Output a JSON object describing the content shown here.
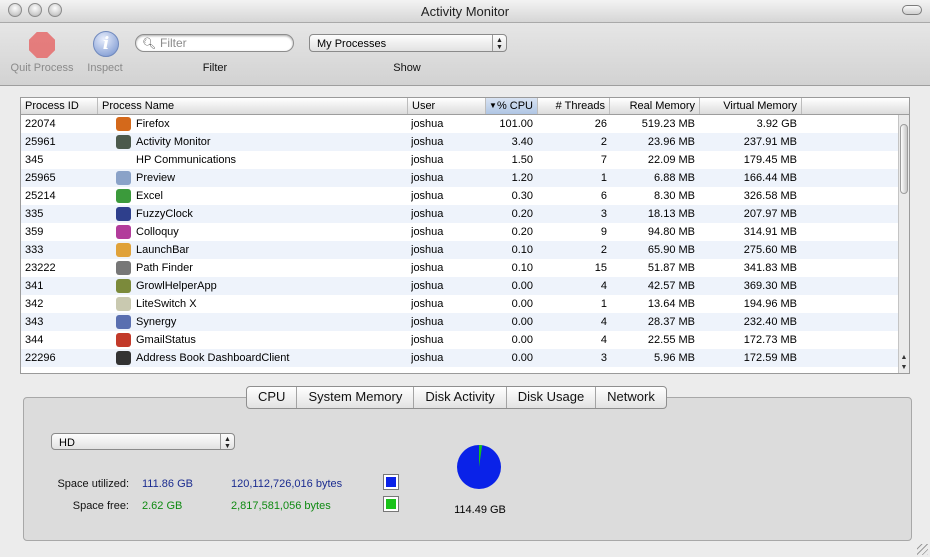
{
  "window": {
    "title": "Activity Monitor"
  },
  "toolbar": {
    "quit_label": "Quit Process",
    "inspect_label": "Inspect",
    "filter_placeholder": "Filter",
    "filter_label": "Filter",
    "show_value": "My Processes",
    "show_label": "Show"
  },
  "table": {
    "columns": [
      "Process ID",
      "Process Name",
      "User",
      "% CPU",
      "# Threads",
      "Real Memory",
      "Virtual Memory"
    ],
    "sorted_column": "% CPU",
    "rows": [
      {
        "pid": "22074",
        "name": "Firefox",
        "user": "joshua",
        "cpu": "101.00",
        "threads": "26",
        "real": "519.23 MB",
        "virtual": "3.92 GB",
        "icon": "firefox-icon",
        "color": "#d4691b"
      },
      {
        "pid": "25961",
        "name": "Activity Monitor",
        "user": "joshua",
        "cpu": "3.40",
        "threads": "2",
        "real": "23.96 MB",
        "virtual": "237.91 MB",
        "icon": "activity-monitor-icon",
        "color": "#4c5a4c"
      },
      {
        "pid": "345",
        "name": "HP Communications",
        "user": "joshua",
        "cpu": "1.50",
        "threads": "7",
        "real": "22.09 MB",
        "virtual": "179.45 MB",
        "icon": "",
        "color": ""
      },
      {
        "pid": "25965",
        "name": "Preview",
        "user": "joshua",
        "cpu": "1.20",
        "threads": "1",
        "real": "6.88 MB",
        "virtual": "166.44 MB",
        "icon": "preview-icon",
        "color": "#8aa2c8"
      },
      {
        "pid": "25214",
        "name": "Excel",
        "user": "joshua",
        "cpu": "0.30",
        "threads": "6",
        "real": "8.30 MB",
        "virtual": "326.58 MB",
        "icon": "excel-icon",
        "color": "#3b9a3b"
      },
      {
        "pid": "335",
        "name": "FuzzyClock",
        "user": "joshua",
        "cpu": "0.20",
        "threads": "3",
        "real": "18.13 MB",
        "virtual": "207.97 MB",
        "icon": "fuzzyclock-icon",
        "color": "#2e3f8c"
      },
      {
        "pid": "359",
        "name": "Colloquy",
        "user": "joshua",
        "cpu": "0.20",
        "threads": "9",
        "real": "94.80 MB",
        "virtual": "314.91 MB",
        "icon": "colloquy-icon",
        "color": "#b23c9b"
      },
      {
        "pid": "333",
        "name": "LaunchBar",
        "user": "joshua",
        "cpu": "0.10",
        "threads": "2",
        "real": "65.90 MB",
        "virtual": "275.60 MB",
        "icon": "launchbar-icon",
        "color": "#e0a23a"
      },
      {
        "pid": "23222",
        "name": "Path Finder",
        "user": "joshua",
        "cpu": "0.10",
        "threads": "15",
        "real": "51.87 MB",
        "virtual": "341.83 MB",
        "icon": "path-finder-icon",
        "color": "#777777"
      },
      {
        "pid": "341",
        "name": "GrowlHelperApp",
        "user": "joshua",
        "cpu": "0.00",
        "threads": "4",
        "real": "42.57 MB",
        "virtual": "369.30 MB",
        "icon": "growl-icon",
        "color": "#7b8a3b"
      },
      {
        "pid": "342",
        "name": "LiteSwitch X",
        "user": "joshua",
        "cpu": "0.00",
        "threads": "1",
        "real": "13.64 MB",
        "virtual": "194.96 MB",
        "icon": "liteswitch-icon",
        "color": "#c9c9b0"
      },
      {
        "pid": "343",
        "name": "Synergy",
        "user": "joshua",
        "cpu": "0.00",
        "threads": "4",
        "real": "28.37 MB",
        "virtual": "232.40 MB",
        "icon": "synergy-icon",
        "color": "#5a6fb0"
      },
      {
        "pid": "344",
        "name": "GmailStatus",
        "user": "joshua",
        "cpu": "0.00",
        "threads": "4",
        "real": "22.55 MB",
        "virtual": "172.73 MB",
        "icon": "gmailstatus-icon",
        "color": "#c23a2a"
      },
      {
        "pid": "22296",
        "name": "Address Book DashboardClient",
        "user": "joshua",
        "cpu": "0.00",
        "threads": "3",
        "real": "5.96 MB",
        "virtual": "172.59 MB",
        "icon": "dashboard-icon",
        "color": "#333333"
      }
    ]
  },
  "tabs": [
    "CPU",
    "System Memory",
    "Disk Activity",
    "Disk Usage",
    "Network"
  ],
  "disk": {
    "volume": "HD",
    "used_label": "Space utilized:",
    "used_gb": "111.86 GB",
    "used_bytes": "120,112,726,016 bytes",
    "free_label": "Space free:",
    "free_gb": "2.62 GB",
    "free_bytes": "2,817,581,056 bytes",
    "total": "114.49 GB",
    "used_fraction": 0.977,
    "used_color": "#0a22e8",
    "free_color": "#19c219"
  }
}
